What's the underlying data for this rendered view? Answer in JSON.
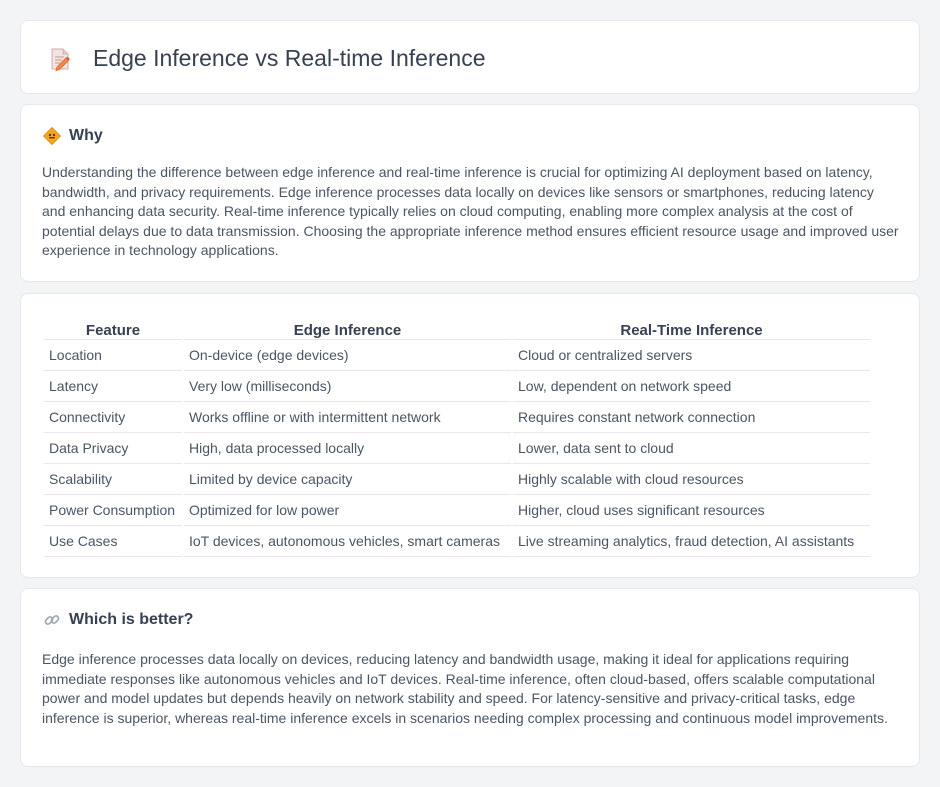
{
  "header": {
    "title": "Edge Inference vs Real-time Inference",
    "icon": "document-edit-icon"
  },
  "why": {
    "icon": "diamond-sign-icon",
    "title": "Why",
    "body": "Understanding the difference between edge inference and real-time inference is crucial for optimizing AI deployment based on latency, bandwidth, and privacy requirements. Edge inference processes data locally on devices like sensors or smartphones, reducing latency and enhancing data security. Real-time inference typically relies on cloud computing, enabling more complex analysis at the cost of potential delays due to data transmission. Choosing the appropriate inference method ensures efficient resource usage and improved user experience in technology applications."
  },
  "table": {
    "headers": [
      "Feature",
      "Edge Inference",
      "Real-Time Inference"
    ],
    "rows": [
      [
        "Location",
        "On-device (edge devices)",
        "Cloud or centralized servers"
      ],
      [
        "Latency",
        "Very low (milliseconds)",
        "Low, dependent on network speed"
      ],
      [
        "Connectivity",
        "Works offline or with intermittent network",
        "Requires constant network connection"
      ],
      [
        "Data Privacy",
        "High, data processed locally",
        "Lower, data sent to cloud"
      ],
      [
        "Scalability",
        "Limited by device capacity",
        "Highly scalable with cloud resources"
      ],
      [
        "Power Consumption",
        "Optimized for low power",
        "Higher, cloud uses significant resources"
      ],
      [
        "Use Cases",
        "IoT devices, autonomous vehicles, smart cameras",
        "Live streaming analytics, fraud detection, AI assistants"
      ]
    ]
  },
  "better": {
    "icon": "link-icon",
    "title": "Which is better?",
    "body": "Edge inference processes data locally on devices, reducing latency and bandwidth usage, making it ideal for applications requiring immediate responses like autonomous vehicles and IoT devices. Real-time inference, often cloud-based, offers scalable computational power and model updates but depends heavily on network stability and speed. For latency-sensitive and privacy-critical tasks, edge inference is superior, whereas real-time inference excels in scenarios needing complex processing and continuous model improvements."
  }
}
